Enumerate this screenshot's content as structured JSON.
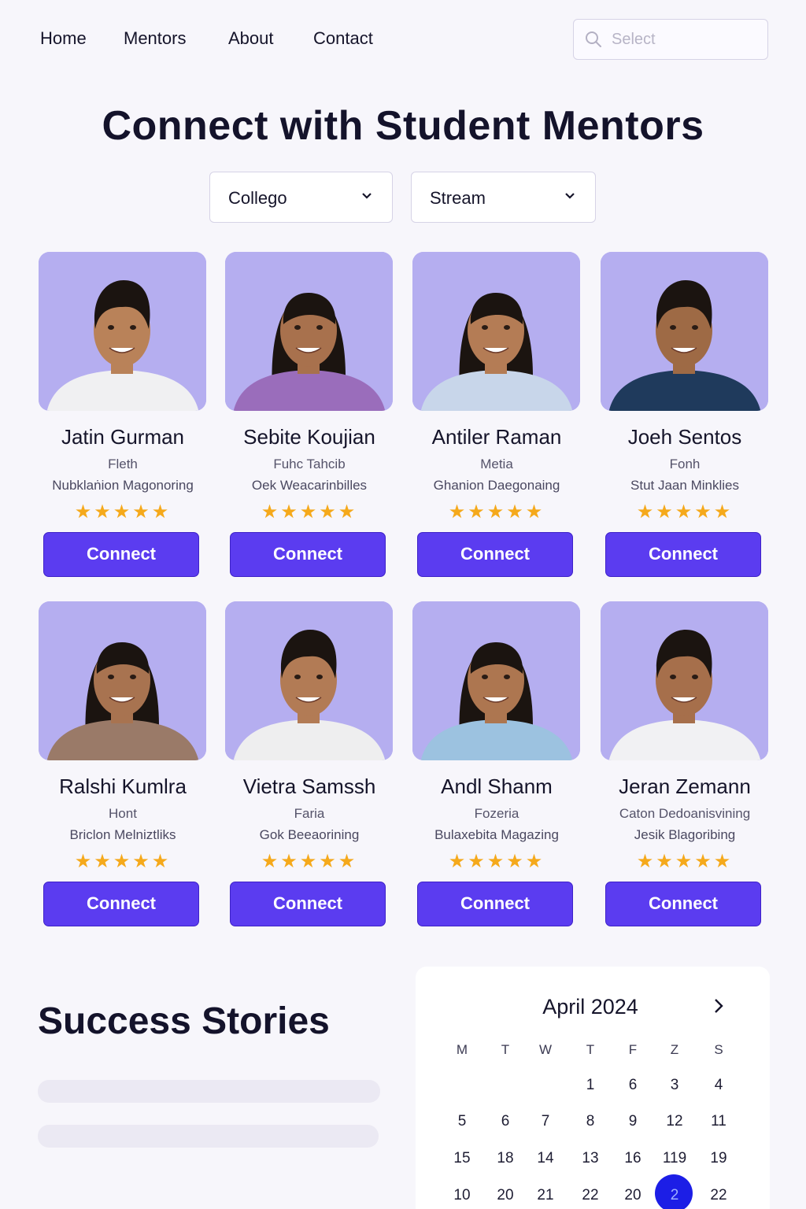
{
  "nav": {
    "links": [
      "Home",
      "Mentors",
      "About",
      "Contact"
    ],
    "search_placeholder": "Select"
  },
  "hero": {
    "title": "Connect with Student Mentors"
  },
  "filters": {
    "college": "Collego",
    "stream": "Stream"
  },
  "mentors": [
    {
      "name": "Jatin Gurman",
      "line1": "Fleth",
      "line2": "Nubklaṅion Magonoring",
      "button": "Connect"
    },
    {
      "name": "Sebite Koujian",
      "line1": "Fuhc Tahcib",
      "line2": "Oek Weacarinbilles",
      "button": "Connect"
    },
    {
      "name": "Antiler Raman",
      "line1": "Metia",
      "line2": "Ghanion Daegonaing",
      "button": "Connect"
    },
    {
      "name": "Joeh Sentos",
      "line1": "Fonh",
      "line2": "Stut Jaan Minklies",
      "button": "Connect"
    },
    {
      "name": "Ralshi Kumlra",
      "line1": "Hont",
      "line2": "Briclon Melniztliks",
      "button": "Connect"
    },
    {
      "name": "Vietra Samssh",
      "line1": "Faria",
      "line2": "Gok Beeaorining",
      "button": "Connect"
    },
    {
      "name": "Andl Shanm",
      "line1": "Fozeria",
      "line2": "Bulaxebita Magazing",
      "button": "Connect"
    },
    {
      "name": "Jeran Zemann",
      "line1": "Caton Dedoanisvining",
      "line2": "Jesik Blagoribing",
      "button": "Connect"
    }
  ],
  "stars": "★★★★★",
  "stories": {
    "title": "Success Stories"
  },
  "calendar": {
    "month": "April 2024",
    "weekdays": [
      "M",
      "T",
      "W",
      "T",
      "F",
      "Z",
      "S"
    ],
    "rows": [
      [
        "",
        "",
        "",
        "1",
        "6",
        "3",
        "4"
      ],
      [
        "5",
        "6",
        "7",
        "8",
        "9",
        "12",
        "11"
      ],
      [
        "15",
        "18",
        "14",
        "13",
        "16",
        "119",
        "19"
      ],
      [
        "10",
        "20",
        "21",
        "22",
        "20",
        "2",
        "22"
      ]
    ],
    "highlighted": {
      "row": 3,
      "col": 5
    }
  },
  "colors": {
    "accent": "#5b3cf0",
    "star": "#f5a91b",
    "photo_bg": "#b5aef0",
    "today": "#1c1ee6"
  }
}
